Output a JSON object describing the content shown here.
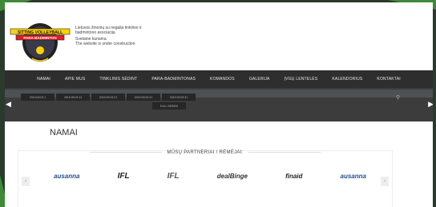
{
  "site": {
    "logo_text_top": "SITTING VOLLEYBALL",
    "logo_text_bottom": "PARA-BADMINTON",
    "tagline": [
      "Lietuvos žmonių su negalia tinklinio ir",
      "badmintono asociacija",
      "Svetainė kuriama",
      "The website is under construction"
    ]
  },
  "nav": {
    "items": [
      "NAMAI",
      "APIE MUS",
      "TINKLINIS SĖDINT",
      "PARA-BADMINTONAS",
      "KOMANDOS",
      "GALERIJA",
      "ĮVGŲ LENTELĖS",
      "KALENDORIUS",
      "KONTAKTAI"
    ]
  },
  "banner": {
    "thumbs": [
      "2019.09.03 1",
      "2019.09.03 11",
      "2019.09.03 21",
      "2019.09.03 21",
      "2019.09.03 31",
      "FULL SERIES"
    ]
  },
  "main": {
    "title": "NAMAI",
    "partners_title": "MŪSŲ PARTNERIAI / RĖMĖJAI:",
    "partners": [
      "ausanna",
      "IFL",
      "IFL",
      "dealBinge",
      "finaid",
      "ausanna"
    ]
  },
  "colors": {
    "accent_green": "#3f8a3a",
    "nav_bg": "#2e2e2e"
  }
}
